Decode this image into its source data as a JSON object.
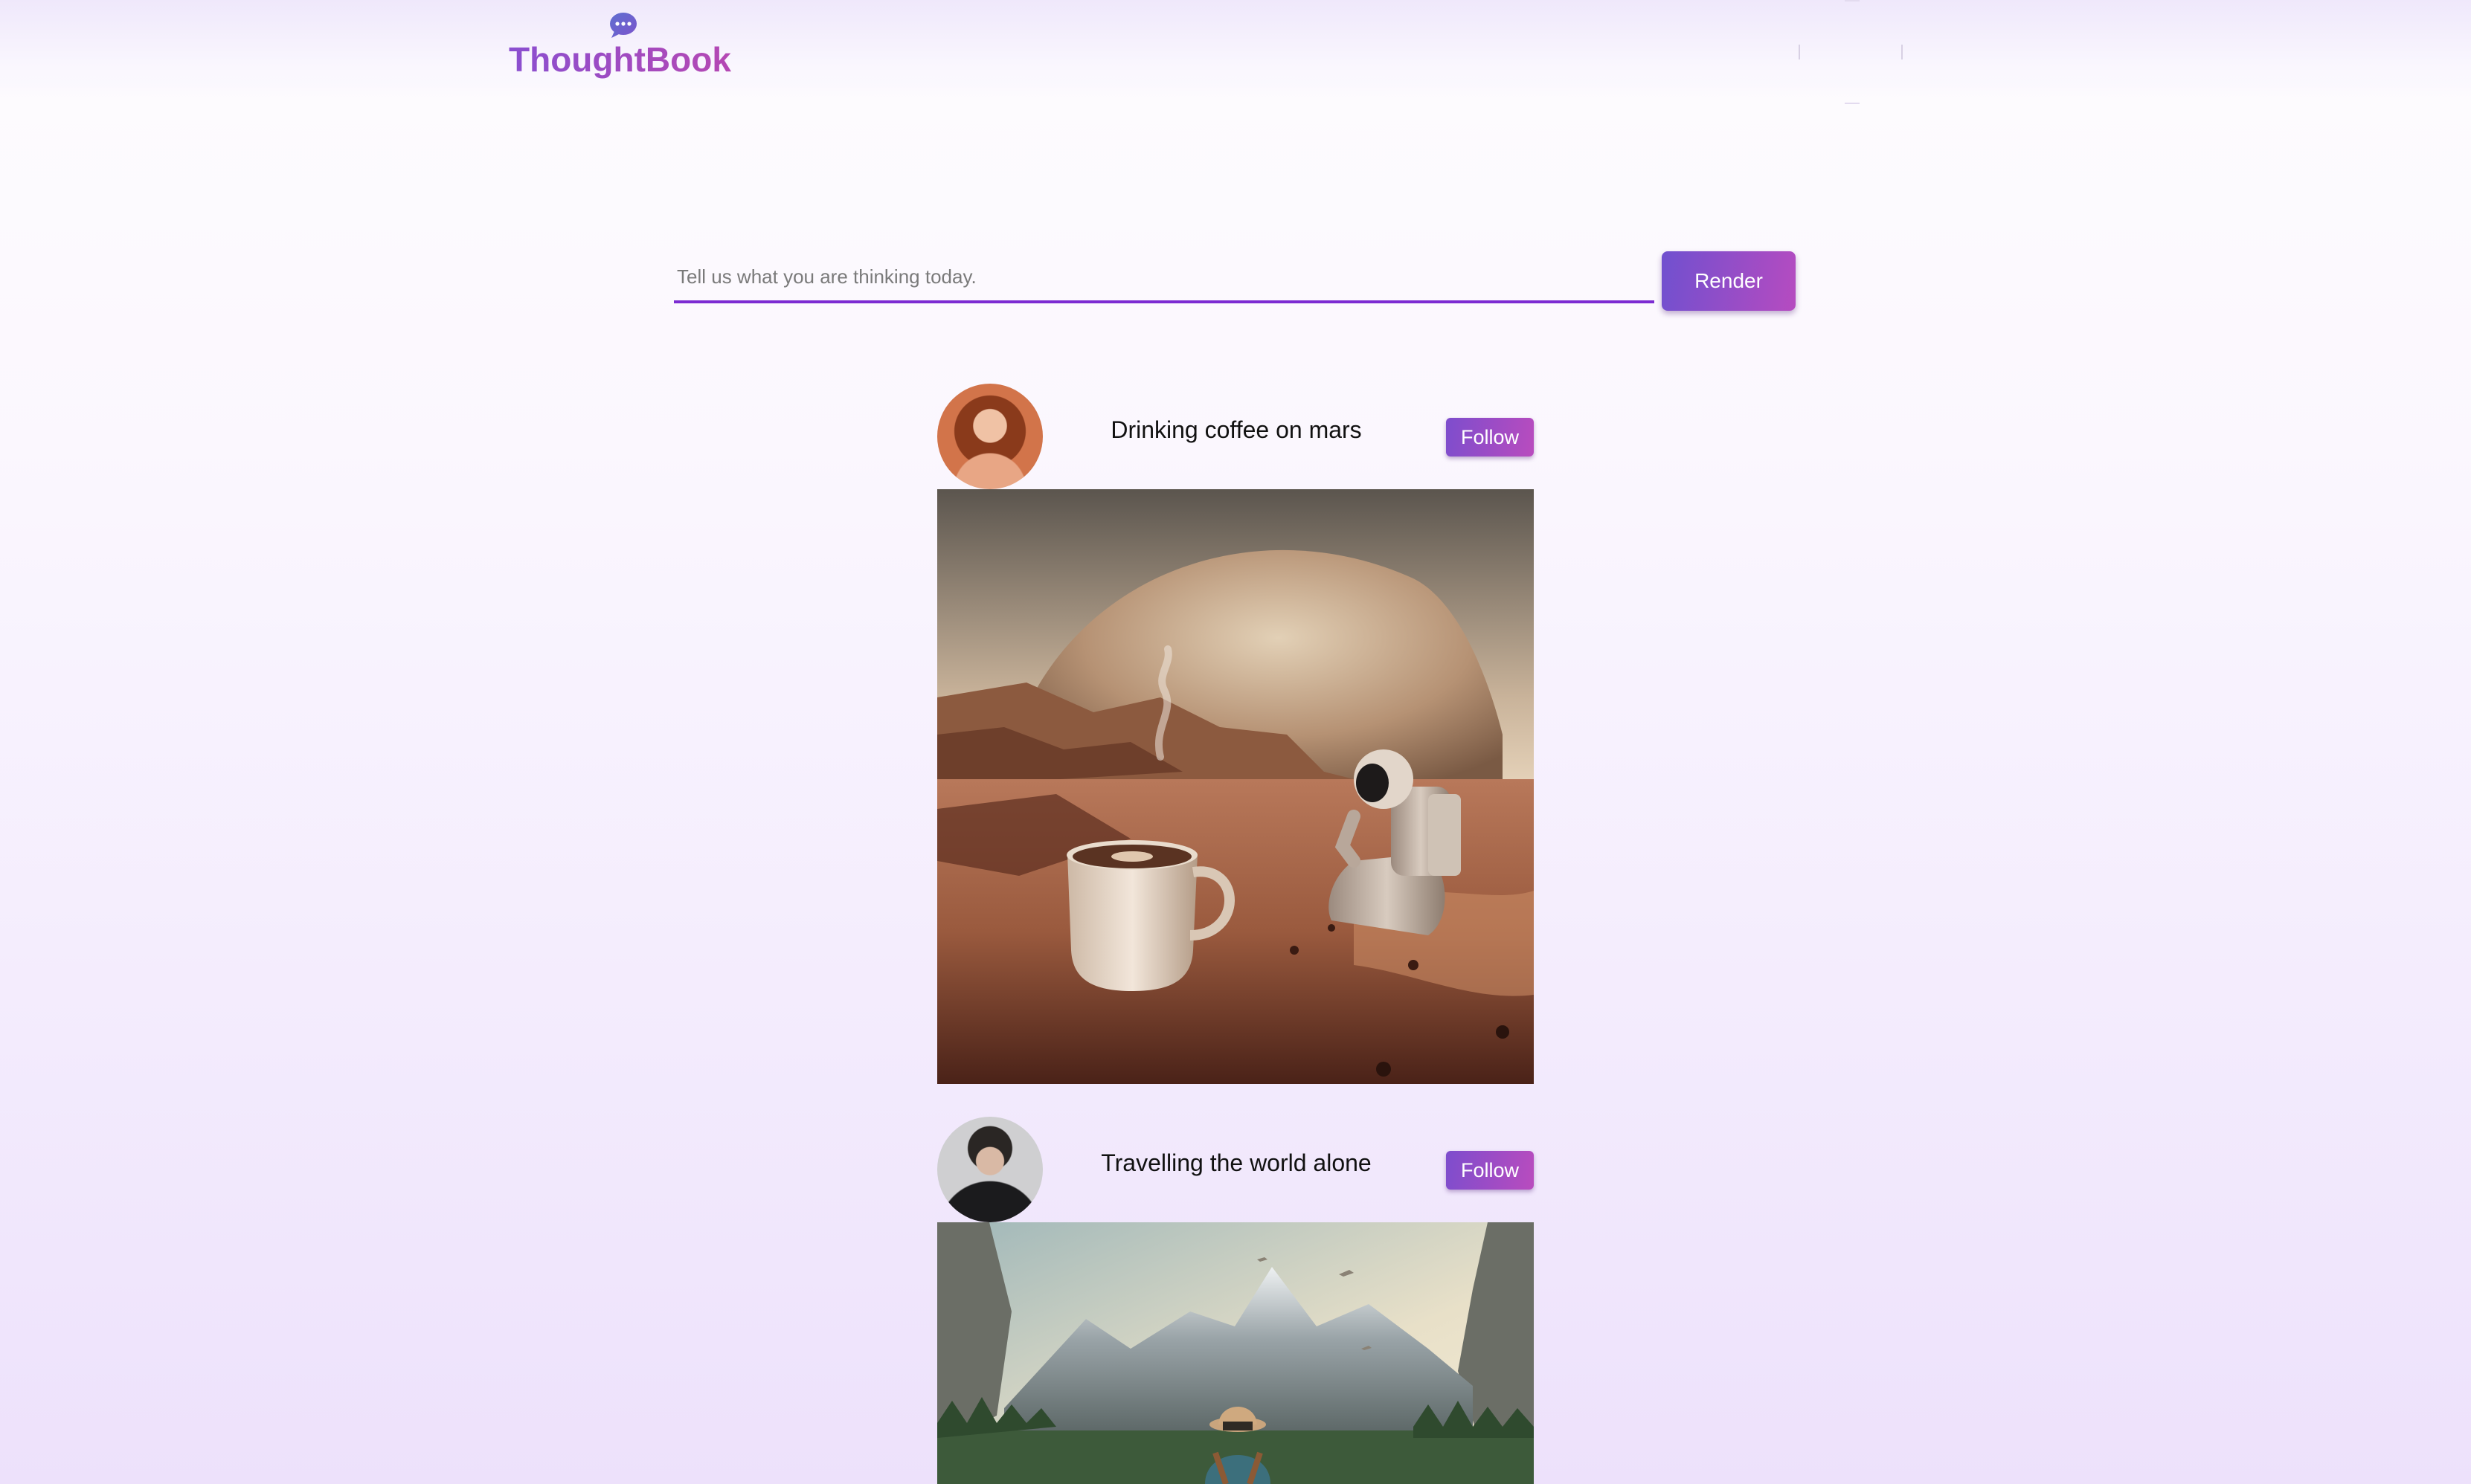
{
  "app": {
    "name": "ThoughtBook",
    "logo_icon": "chat-bubble-dots-icon"
  },
  "prompt": {
    "placeholder": "Tell us what you are thinking today.",
    "value": "",
    "submit_label": "Render"
  },
  "posts": [
    {
      "title": "Drinking coffee on mars",
      "follow_label": "Follow",
      "avatar": "woman-avatar",
      "image": "astronaut-coffee-mars-image"
    },
    {
      "title": "Travelling the world alone",
      "follow_label": "Follow",
      "avatar": "man-avatar",
      "image": "traveller-mountains-image"
    }
  ],
  "colors": {
    "accent": "#7c2bd2",
    "button_start": "#7050cf",
    "button_end": "#b64bc0",
    "logo_start": "#8a4fd0",
    "logo_end": "#b548b3"
  }
}
